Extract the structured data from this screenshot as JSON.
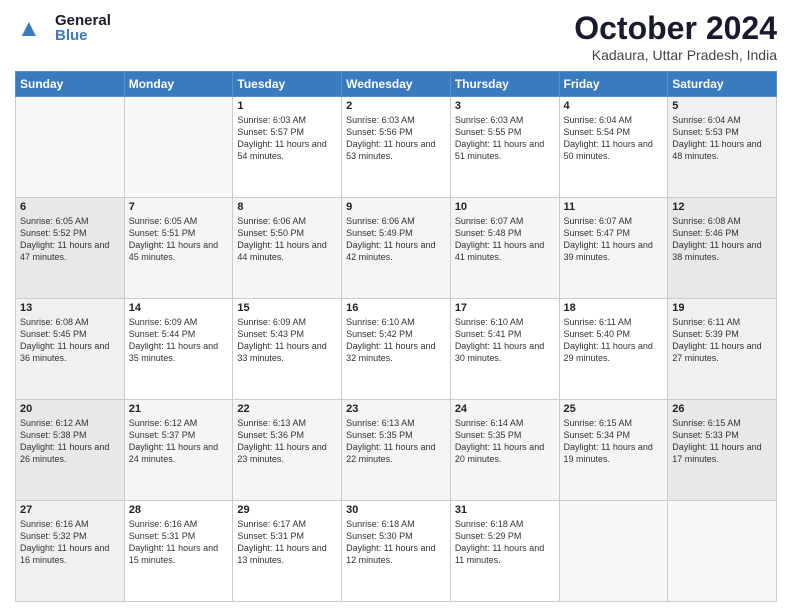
{
  "header": {
    "logo_general": "General",
    "logo_blue": "Blue",
    "title": "October 2024",
    "subtitle": "Kadaura, Uttar Pradesh, India"
  },
  "days_of_week": [
    "Sunday",
    "Monday",
    "Tuesday",
    "Wednesday",
    "Thursday",
    "Friday",
    "Saturday"
  ],
  "weeks": [
    [
      {
        "day": "",
        "info": ""
      },
      {
        "day": "",
        "info": ""
      },
      {
        "day": "1",
        "info": "Sunrise: 6:03 AM\nSunset: 5:57 PM\nDaylight: 11 hours\nand 54 minutes."
      },
      {
        "day": "2",
        "info": "Sunrise: 6:03 AM\nSunset: 5:56 PM\nDaylight: 11 hours\nand 53 minutes."
      },
      {
        "day": "3",
        "info": "Sunrise: 6:03 AM\nSunset: 5:55 PM\nDaylight: 11 hours\nand 51 minutes."
      },
      {
        "day": "4",
        "info": "Sunrise: 6:04 AM\nSunset: 5:54 PM\nDaylight: 11 hours\nand 50 minutes."
      },
      {
        "day": "5",
        "info": "Sunrise: 6:04 AM\nSunset: 5:53 PM\nDaylight: 11 hours\nand 48 minutes."
      }
    ],
    [
      {
        "day": "6",
        "info": "Sunrise: 6:05 AM\nSunset: 5:52 PM\nDaylight: 11 hours\nand 47 minutes."
      },
      {
        "day": "7",
        "info": "Sunrise: 6:05 AM\nSunset: 5:51 PM\nDaylight: 11 hours\nand 45 minutes."
      },
      {
        "day": "8",
        "info": "Sunrise: 6:06 AM\nSunset: 5:50 PM\nDaylight: 11 hours\nand 44 minutes."
      },
      {
        "day": "9",
        "info": "Sunrise: 6:06 AM\nSunset: 5:49 PM\nDaylight: 11 hours\nand 42 minutes."
      },
      {
        "day": "10",
        "info": "Sunrise: 6:07 AM\nSunset: 5:48 PM\nDaylight: 11 hours\nand 41 minutes."
      },
      {
        "day": "11",
        "info": "Sunrise: 6:07 AM\nSunset: 5:47 PM\nDaylight: 11 hours\nand 39 minutes."
      },
      {
        "day": "12",
        "info": "Sunrise: 6:08 AM\nSunset: 5:46 PM\nDaylight: 11 hours\nand 38 minutes."
      }
    ],
    [
      {
        "day": "13",
        "info": "Sunrise: 6:08 AM\nSunset: 5:45 PM\nDaylight: 11 hours\nand 36 minutes."
      },
      {
        "day": "14",
        "info": "Sunrise: 6:09 AM\nSunset: 5:44 PM\nDaylight: 11 hours\nand 35 minutes."
      },
      {
        "day": "15",
        "info": "Sunrise: 6:09 AM\nSunset: 5:43 PM\nDaylight: 11 hours\nand 33 minutes."
      },
      {
        "day": "16",
        "info": "Sunrise: 6:10 AM\nSunset: 5:42 PM\nDaylight: 11 hours\nand 32 minutes."
      },
      {
        "day": "17",
        "info": "Sunrise: 6:10 AM\nSunset: 5:41 PM\nDaylight: 11 hours\nand 30 minutes."
      },
      {
        "day": "18",
        "info": "Sunrise: 6:11 AM\nSunset: 5:40 PM\nDaylight: 11 hours\nand 29 minutes."
      },
      {
        "day": "19",
        "info": "Sunrise: 6:11 AM\nSunset: 5:39 PM\nDaylight: 11 hours\nand 27 minutes."
      }
    ],
    [
      {
        "day": "20",
        "info": "Sunrise: 6:12 AM\nSunset: 5:38 PM\nDaylight: 11 hours\nand 26 minutes."
      },
      {
        "day": "21",
        "info": "Sunrise: 6:12 AM\nSunset: 5:37 PM\nDaylight: 11 hours\nand 24 minutes."
      },
      {
        "day": "22",
        "info": "Sunrise: 6:13 AM\nSunset: 5:36 PM\nDaylight: 11 hours\nand 23 minutes."
      },
      {
        "day": "23",
        "info": "Sunrise: 6:13 AM\nSunset: 5:35 PM\nDaylight: 11 hours\nand 22 minutes."
      },
      {
        "day": "24",
        "info": "Sunrise: 6:14 AM\nSunset: 5:35 PM\nDaylight: 11 hours\nand 20 minutes."
      },
      {
        "day": "25",
        "info": "Sunrise: 6:15 AM\nSunset: 5:34 PM\nDaylight: 11 hours\nand 19 minutes."
      },
      {
        "day": "26",
        "info": "Sunrise: 6:15 AM\nSunset: 5:33 PM\nDaylight: 11 hours\nand 17 minutes."
      }
    ],
    [
      {
        "day": "27",
        "info": "Sunrise: 6:16 AM\nSunset: 5:32 PM\nDaylight: 11 hours\nand 16 minutes."
      },
      {
        "day": "28",
        "info": "Sunrise: 6:16 AM\nSunset: 5:31 PM\nDaylight: 11 hours\nand 15 minutes."
      },
      {
        "day": "29",
        "info": "Sunrise: 6:17 AM\nSunset: 5:31 PM\nDaylight: 11 hours\nand 13 minutes."
      },
      {
        "day": "30",
        "info": "Sunrise: 6:18 AM\nSunset: 5:30 PM\nDaylight: 11 hours\nand 12 minutes."
      },
      {
        "day": "31",
        "info": "Sunrise: 6:18 AM\nSunset: 5:29 PM\nDaylight: 11 hours\nand 11 minutes."
      },
      {
        "day": "",
        "info": ""
      },
      {
        "day": "",
        "info": ""
      }
    ]
  ]
}
